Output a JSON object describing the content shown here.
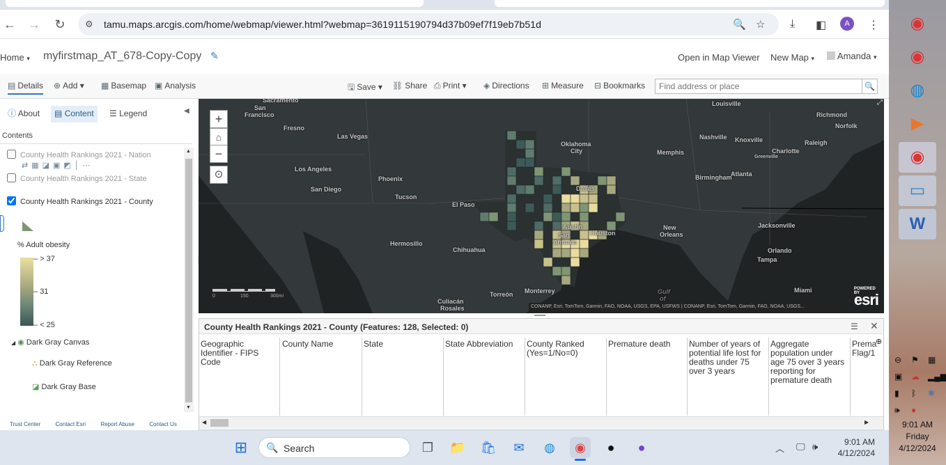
{
  "browser": {
    "url": "tamu.maps.arcgis.com/home/webmap/viewer.html?webmap=3619115190794d37b09ef7f19eb7b51d",
    "avatar_letter": "A"
  },
  "header": {
    "home": "Home",
    "map_title": "myfirstmap_AT_678-Copy-Copy",
    "open_map_viewer": "Open in Map Viewer",
    "new_map": "New Map",
    "user": "Amanda"
  },
  "toolbar": {
    "details": "Details",
    "add": "Add",
    "basemap": "Basemap",
    "analysis": "Analysis",
    "save": "Save",
    "share": "Share",
    "print": "Print",
    "directions": "Directions",
    "measure": "Measure",
    "bookmarks": "Bookmarks",
    "search_placeholder": "Find address or place"
  },
  "panel": {
    "tabs": {
      "about": "About",
      "content": "Content",
      "legend": "Legend"
    },
    "contents_label": "Contents",
    "layers": [
      {
        "name": "County Health Rankings 2021 - Nation",
        "checked": false
      },
      {
        "name": "County Health Rankings 2021 - State",
        "checked": false
      },
      {
        "name": "County Health Rankings 2021 - County",
        "checked": true
      }
    ],
    "legend_field": "% Adult obesity",
    "legend_high": "> 37",
    "legend_mid": "31",
    "legend_low": "< 25",
    "basemap_group": "Dark Gray Canvas",
    "basemap_ref": "Dark Gray Reference",
    "basemap_base": "Dark Gray Base",
    "footer": [
      "Trust Center",
      "Contact Esri",
      "Report Abuse",
      "Contact Us"
    ]
  },
  "map": {
    "labels": [
      {
        "t": "Sacramento",
        "c": "sac"
      },
      {
        "t": "San",
        "c": "sf1"
      },
      {
        "t": "Francisco",
        "c": "sf2"
      },
      {
        "t": "Fresno",
        "c": "fre"
      },
      {
        "t": "Las Vegas",
        "c": "lv"
      },
      {
        "t": "Los Angeles",
        "c": "la"
      },
      {
        "t": "San Diego",
        "c": "sd"
      },
      {
        "t": "Phoenix",
        "c": "phx"
      },
      {
        "t": "Tucson",
        "c": "tuc"
      },
      {
        "t": "El Paso",
        "c": "elp"
      },
      {
        "t": "Hermosillo",
        "c": "her"
      },
      {
        "t": "Chihuahua",
        "c": "chi"
      },
      {
        "t": "Oklahoma",
        "c": "ok1"
      },
      {
        "t": "City",
        "c": "ok2"
      },
      {
        "t": "Dallas",
        "c": "dal"
      },
      {
        "t": "Austin",
        "c": "aus"
      },
      {
        "t": "San",
        "c": "sa1"
      },
      {
        "t": "Antonio",
        "c": "sa2"
      },
      {
        "t": "Houston",
        "c": "hou"
      },
      {
        "t": "Monterrey",
        "c": "mon"
      },
      {
        "t": "Torreón",
        "c": "tor"
      },
      {
        "t": "Culiacán",
        "c": "cul"
      },
      {
        "t": "Rosales",
        "c": "ros"
      },
      {
        "t": "Memphis",
        "c": "mem"
      },
      {
        "t": "Nashville",
        "c": "nas"
      },
      {
        "t": "Louisville",
        "c": "lou"
      },
      {
        "t": "Knoxville",
        "c": "kno"
      },
      {
        "t": "Richmond",
        "c": "ric"
      },
      {
        "t": "Norfolk",
        "c": "nor"
      },
      {
        "t": "Raleigh",
        "c": "ral"
      },
      {
        "t": "Charlotte",
        "c": "cha"
      },
      {
        "t": "Greenville",
        "c": "gre"
      },
      {
        "t": "Atlanta",
        "c": "atl"
      },
      {
        "t": "Birmingham",
        "c": "bir"
      },
      {
        "t": "New",
        "c": "no1"
      },
      {
        "t": "Orleans",
        "c": "no2"
      },
      {
        "t": "Jacksonville",
        "c": "jax"
      },
      {
        "t": "Orlando",
        "c": "orl"
      },
      {
        "t": "Tampa",
        "c": "tam"
      },
      {
        "t": "Miami",
        "c": "mia"
      },
      {
        "t": "Gulf",
        "c": "gu1"
      },
      {
        "t": "of",
        "c": "gu2"
      }
    ],
    "scale_labels": [
      "0",
      "150",
      "300mi"
    ],
    "attribution": "CONANP, Esri, TomTom, Garmin, FAO, NOAA, USGS, EPA, USFWS | CONANP, Esri, TomTom, Garmin, FAO, NOAA, USGS...",
    "esri_powered": "POWERED BY",
    "esri": "esri",
    "colors": {
      "low": "#3d5a58",
      "mid": "#7f9574",
      "high": "#e8dca0"
    }
  },
  "table": {
    "title": "County Health Rankings 2021 - County (Features: 128, Selected: 0)",
    "columns": [
      "Geographic Identifier - FIPS Code",
      "County Name",
      "State",
      "State Abbreviation",
      "County Ranked (Yes=1/No=0)",
      "Premature death",
      "Number of years of potential life lost for deaths under 75 over 3 years",
      "Aggregate population under age 75 over 3 years reporting for premature death",
      "Prema Flag/1"
    ]
  },
  "taskbar": {
    "search": "Search",
    "time": "9:01 AM",
    "date": "4/12/2024"
  },
  "side": {
    "time": "9:01 AM",
    "day": "Friday",
    "date": "4/12/2024"
  }
}
